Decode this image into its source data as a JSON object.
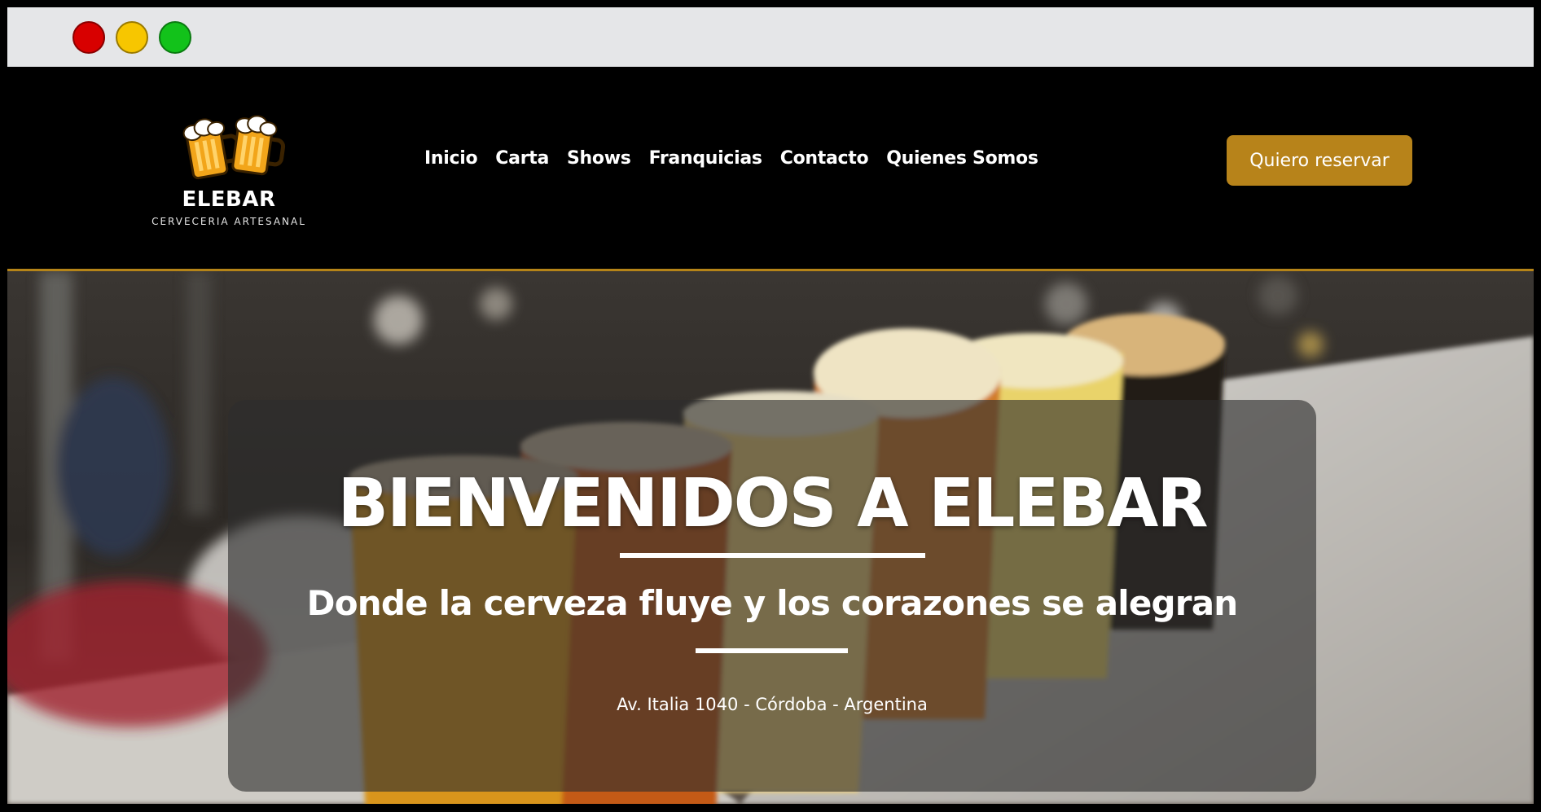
{
  "browser": {
    "controls": [
      "close-dot",
      "minimize-dot",
      "maximize-dot"
    ]
  },
  "header": {
    "logo": {
      "name": "ELEBAR",
      "tagline": "CERVECERIA ARTESANAL",
      "icon": "beer-mugs-icon"
    },
    "nav": [
      {
        "label": "Inicio"
      },
      {
        "label": "Carta"
      },
      {
        "label": "Shows"
      },
      {
        "label": "Franquicias"
      },
      {
        "label": "Contacto"
      },
      {
        "label": "Quienes Somos"
      }
    ],
    "cta_label": "Quiero reservar"
  },
  "hero": {
    "title": "BIENVENIDOS A ELEBAR",
    "subtitle": "Donde la cerveza fluye y los corazones se alegran",
    "address": "Av. Italia 1040 - Córdoba - Argentina"
  },
  "colors": {
    "accent": "#b7831a",
    "background": "#000000",
    "text": "#ffffff"
  }
}
